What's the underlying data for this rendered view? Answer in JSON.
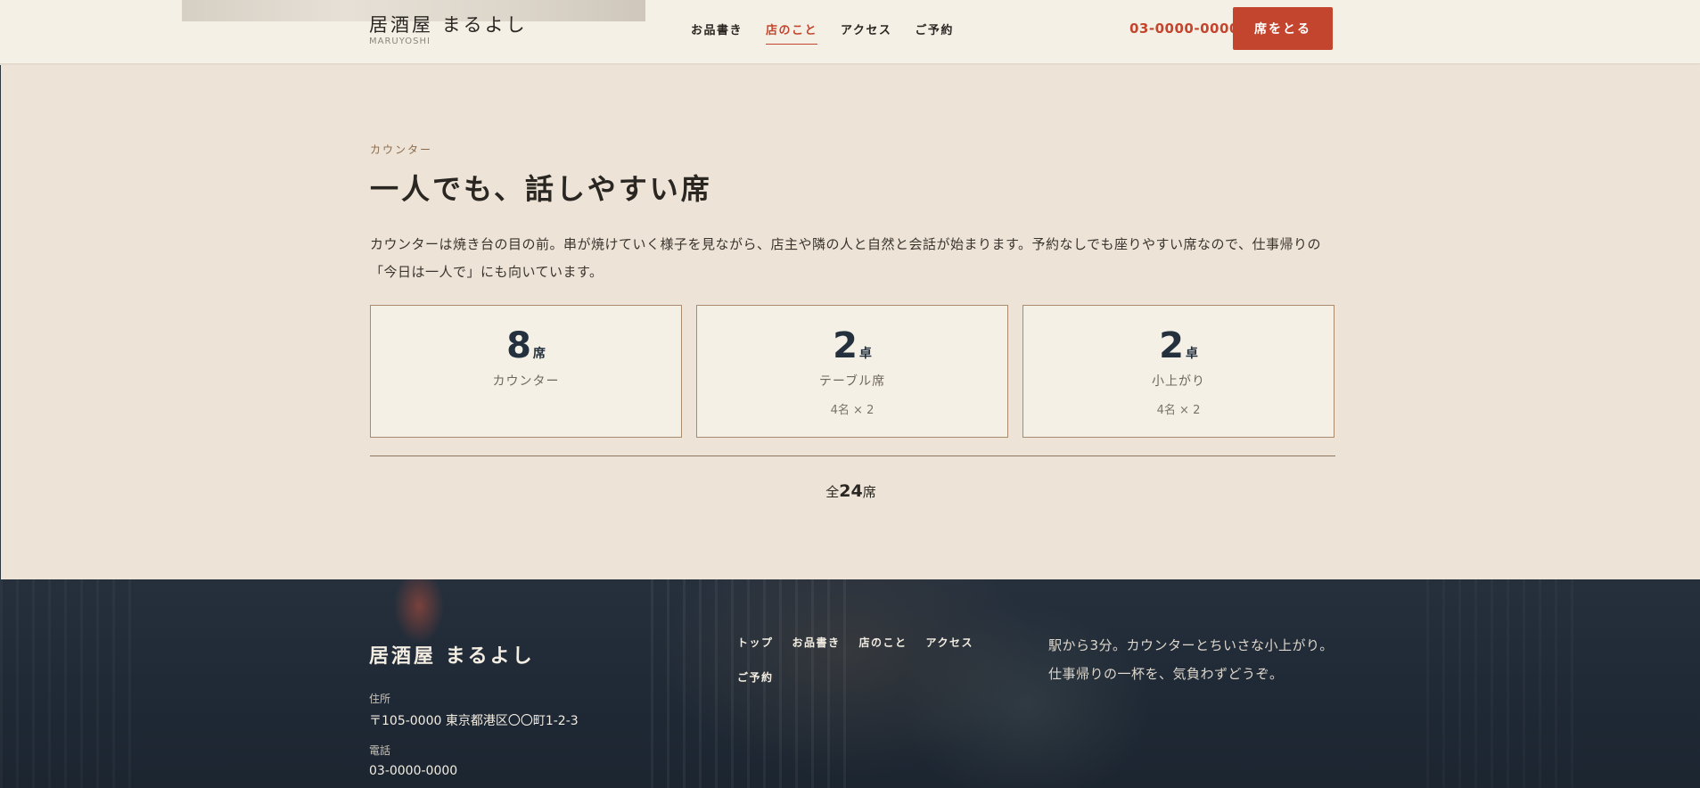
{
  "header": {
    "logo": "居酒屋 まるよし",
    "logo_sub": "MARUYOSHI",
    "nav": [
      {
        "label": "お品書き",
        "active": false
      },
      {
        "label": "店のこと",
        "active": true
      },
      {
        "label": "アクセス",
        "active": false
      },
      {
        "label": "ご予約",
        "active": false
      }
    ],
    "phone": "03-0000-0000",
    "reserve_label": "席をとる"
  },
  "section": {
    "eyebrow": "カウンター",
    "title": "一人でも、話しやすい席",
    "lead": "カウンターは焼き台の目の前。串が焼けていく様子を見ながら、店主や隣の人と自然と会話が始まります。予約なしでも座りやすい席なので、仕事帰りの「今日は一人で」にも向いています。",
    "cards": [
      {
        "num": "8",
        "unit": "席",
        "label": "カウンター",
        "sub": ""
      },
      {
        "num": "2",
        "unit": "卓",
        "label": "テーブル席",
        "sub": "4名 × 2"
      },
      {
        "num": "2",
        "unit": "卓",
        "label": "小上がり",
        "sub": "4名 × 2"
      }
    ],
    "total_prefix": "全",
    "total_num": "24",
    "total_suffix": "席"
  },
  "footer": {
    "logo": "居酒屋 まるよし",
    "address_label": "住所",
    "address": "〒105-0000 東京都港区〇〇町1-2-3",
    "phone_label": "電話",
    "phone": "03-0000-0000",
    "nav": [
      "トップ",
      "お品書き",
      "店のこと",
      "アクセス",
      "ご予約"
    ],
    "description": "駅から3分。カウンターとちいさな小上がり。仕事帰りの一杯を、気負わずどうぞ。"
  },
  "colors": {
    "accent": "#c4452d",
    "navy": "#24303e",
    "background": "#ede4d7"
  }
}
